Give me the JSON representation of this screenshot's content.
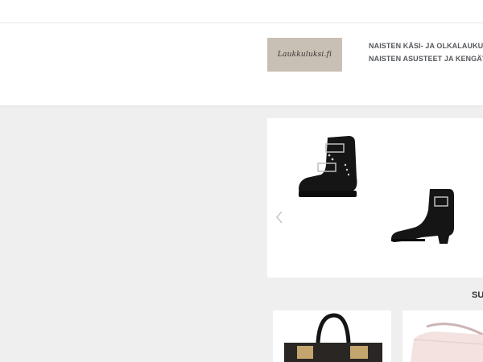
{
  "brand": {
    "logo_text": "Laukkuluksi.fi",
    "logo_bg": "#c8bfb5"
  },
  "nav": {
    "items": [
      {
        "label": "NAISTEN KÄSI- JA OLKALAUKUT"
      },
      {
        "label": "NAISTEN ASUSTEET JA KENGÄT"
      }
    ]
  },
  "slider": {
    "prev_icon": "chevron-left-icon",
    "slides": [
      {
        "icon": "ankle-boot-buckles-image"
      },
      {
        "icon": "heeled-ankle-boot-image"
      }
    ]
  },
  "section": {
    "title": "SU"
  },
  "products": [
    {
      "icon": "black-handbag-image"
    },
    {
      "icon": "pink-bag-image"
    }
  ]
}
